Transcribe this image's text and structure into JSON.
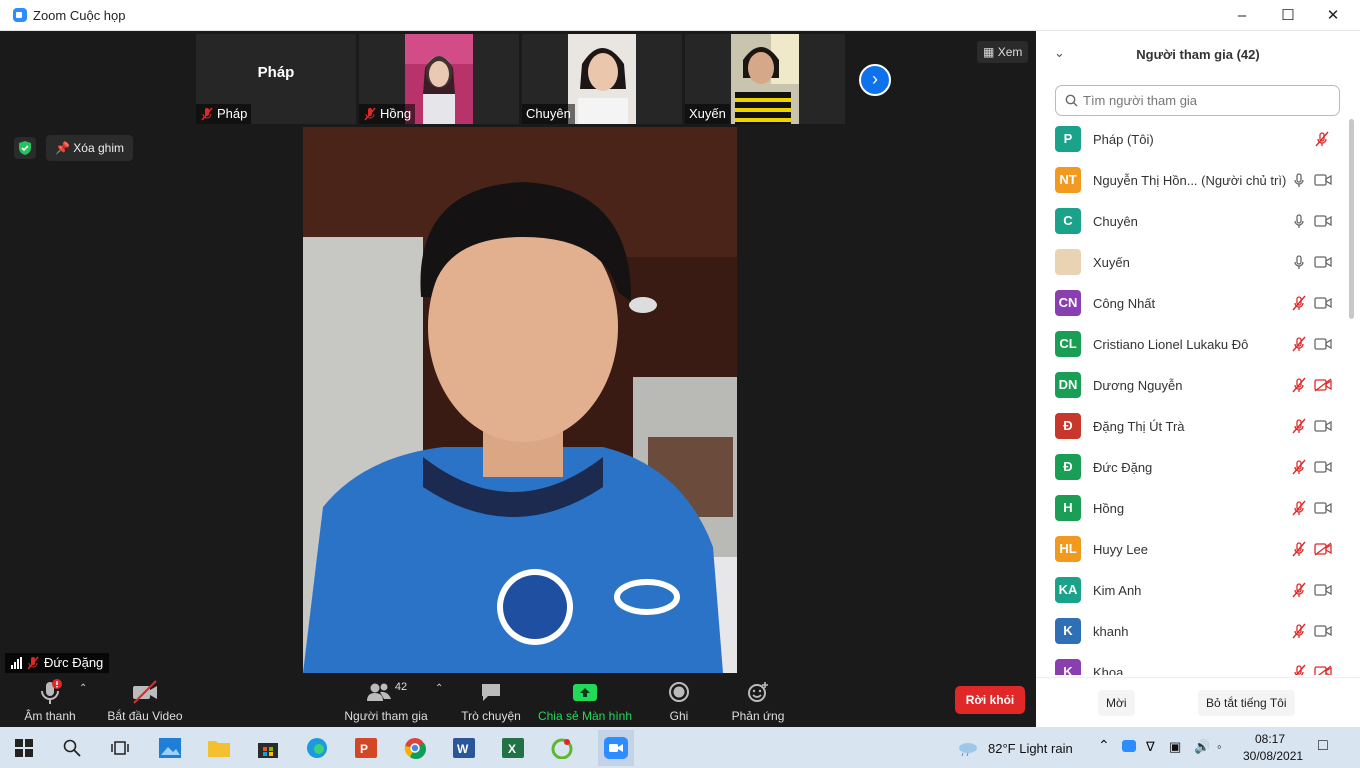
{
  "window": {
    "title": "Zoom Cuộc họp"
  },
  "thumbnails": [
    {
      "name": "Pháp",
      "big_label": "Pháp"
    },
    {
      "name": "Hồng"
    },
    {
      "name": "Chuyên"
    },
    {
      "name": "Xuyến"
    }
  ],
  "meeting": {
    "view_label": "Xem",
    "unpin_label": "Xóa ghim",
    "active_speaker": "Đức Đặng"
  },
  "toolbar": {
    "audio_label": "Âm thanh",
    "video_label": "Bắt đầu Video",
    "participants_label": "Người tham gia",
    "participants_count": "42",
    "chat_label": "Trò chuyện",
    "share_label": "Chia sẻ Màn hình",
    "record_label": "Ghi",
    "reactions_label": "Phản ứng",
    "leave_label": "Rời khỏi"
  },
  "panel": {
    "title": "Người tham gia (42)",
    "search_placeholder": "Tìm người tham gia",
    "participants": [
      {
        "initials": "P",
        "name": "Pháp (Tôi)",
        "color": "#1aa28a",
        "mic": "off",
        "video": "none"
      },
      {
        "initials": "NT",
        "name": "Nguyễn Thị Hồn... (Người chủ trì)",
        "color": "#f29a1f",
        "mic": "on",
        "video": "on"
      },
      {
        "initials": "C",
        "name": "Chuyên",
        "color": "#1aa28a",
        "mic": "on",
        "video": "on"
      },
      {
        "initials": "",
        "name": "Xuyến",
        "color": "#e9d3b3",
        "mic": "on",
        "video": "on"
      },
      {
        "initials": "CN",
        "name": "Công Nhất",
        "color": "#8a3fb0",
        "mic": "off",
        "video": "on"
      },
      {
        "initials": "CL",
        "name": "Cristiano Lionel Lukaku Đô",
        "color": "#1a9e55",
        "mic": "off",
        "video": "on"
      },
      {
        "initials": "DN",
        "name": "Dương Nguyễn",
        "color": "#1a9e55",
        "mic": "off",
        "video": "off"
      },
      {
        "initials": "Đ",
        "name": "Đặng Thị Út Trà",
        "color": "#c7372b",
        "mic": "off",
        "video": "on"
      },
      {
        "initials": "Đ",
        "name": "Đức Đặng",
        "color": "#1a9e55",
        "mic": "off",
        "video": "on"
      },
      {
        "initials": "H",
        "name": "Hồng",
        "color": "#1a9e55",
        "mic": "off",
        "video": "on"
      },
      {
        "initials": "HL",
        "name": "Huyy Lee",
        "color": "#f29a1f",
        "mic": "off",
        "video": "off"
      },
      {
        "initials": "KA",
        "name": "Kim Anh",
        "color": "#1aa28a",
        "mic": "off",
        "video": "on"
      },
      {
        "initials": "K",
        "name": "khanh",
        "color": "#2f6fb5",
        "mic": "off",
        "video": "on"
      },
      {
        "initials": "K",
        "name": "Khoa",
        "color": "#8a3fb0",
        "mic": "off",
        "video": "off"
      }
    ],
    "invite_label": "Mời",
    "mute_all_label": "Bỏ tắt tiếng Tôi"
  },
  "taskbar": {
    "weather": "82°F  Light rain",
    "time": "08:17",
    "date": "30/08/2021"
  },
  "colors": {
    "accent": "#0e72ed",
    "leave": "#e02828",
    "share": "#23d959",
    "mute": "#e02828"
  }
}
